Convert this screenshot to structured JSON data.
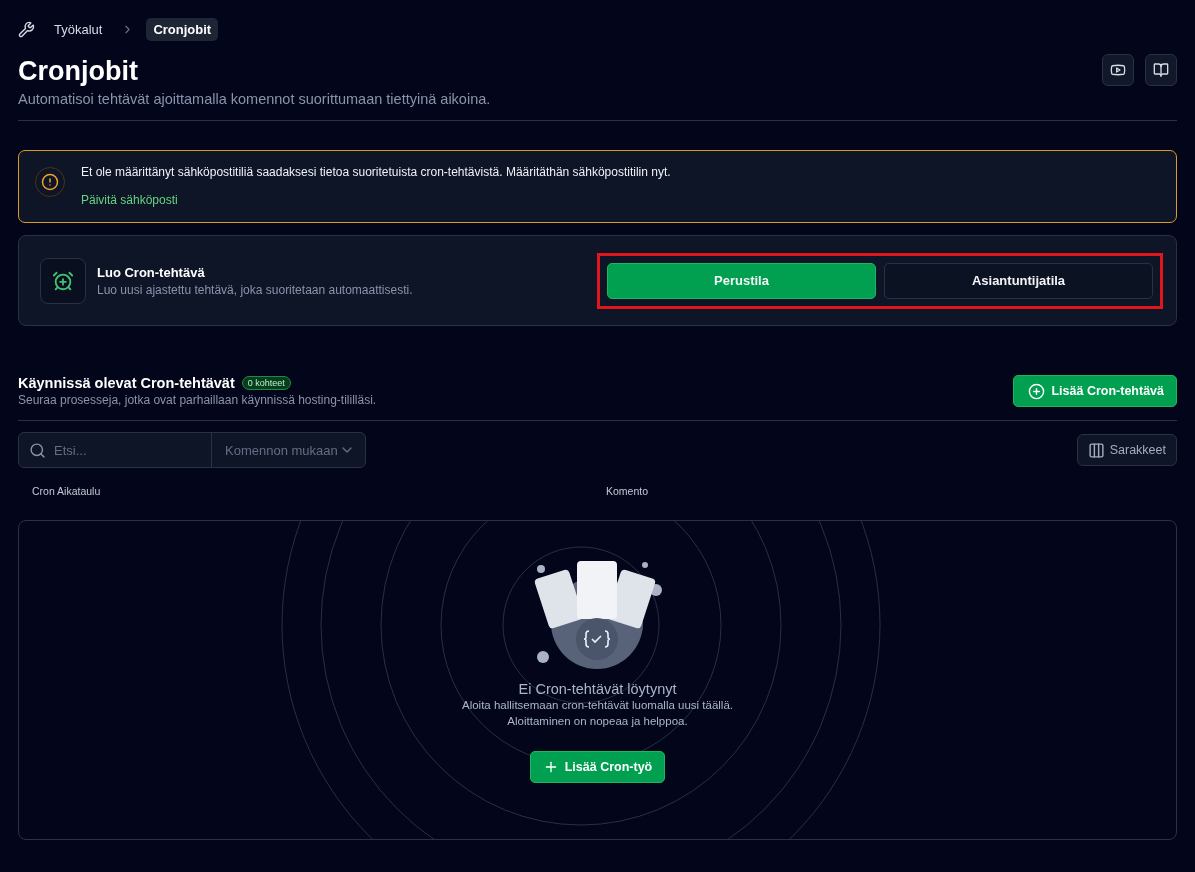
{
  "breadcrumb": {
    "items": [
      {
        "label": "Työkalut",
        "selected": false
      },
      {
        "label": "Cronjobit",
        "selected": true
      }
    ]
  },
  "header": {
    "title": "Cronjobit",
    "subtitle": "Automatisoi tehtävät ajoittamalla komennot suorittumaan tiettyinä aikoina."
  },
  "alert": {
    "message": "Et ole määrittänyt sähköpostitiliä saadaksesi tietoa suoritetuista cron-tehtävistä. Määritäthän sähköpostitilin nyt.",
    "link": "Päivitä sähköposti"
  },
  "create_card": {
    "title": "Luo Cron-tehtävä",
    "description": "Luo uusi ajastettu tehtävä, joka suoritetaan automaattisesti.",
    "highlighted": true,
    "modes": [
      {
        "label": "Perustila",
        "selected": true
      },
      {
        "label": "Asiantuntijatila",
        "selected": false
      }
    ]
  },
  "jobs": {
    "title": "Käynnissä olevat Cron-tehtävät",
    "count_badge": "0 kohteet",
    "subtitle": "Seuraa prosesseja, jotka ovat parhaillaan käynnissä hosting-tililläsi.",
    "add_button": "Lisää Cron-tehtävä",
    "search": {
      "placeholder": "Etsi..."
    },
    "filter": {
      "placeholder": "Komennon mukaan"
    },
    "columns_button": "Sarakkeet",
    "columns": [
      "Cron Aikataulu",
      "Komento"
    ],
    "empty": {
      "title": "Ei Cron-tehtävät löytynyt",
      "lines": [
        "Aloita hallitsemaan cron-tehtävät luomalla uusi täällä.",
        "Aloittaminen on nopeaa ja helppoa."
      ],
      "button": "Lisää Cron-työ"
    }
  }
}
